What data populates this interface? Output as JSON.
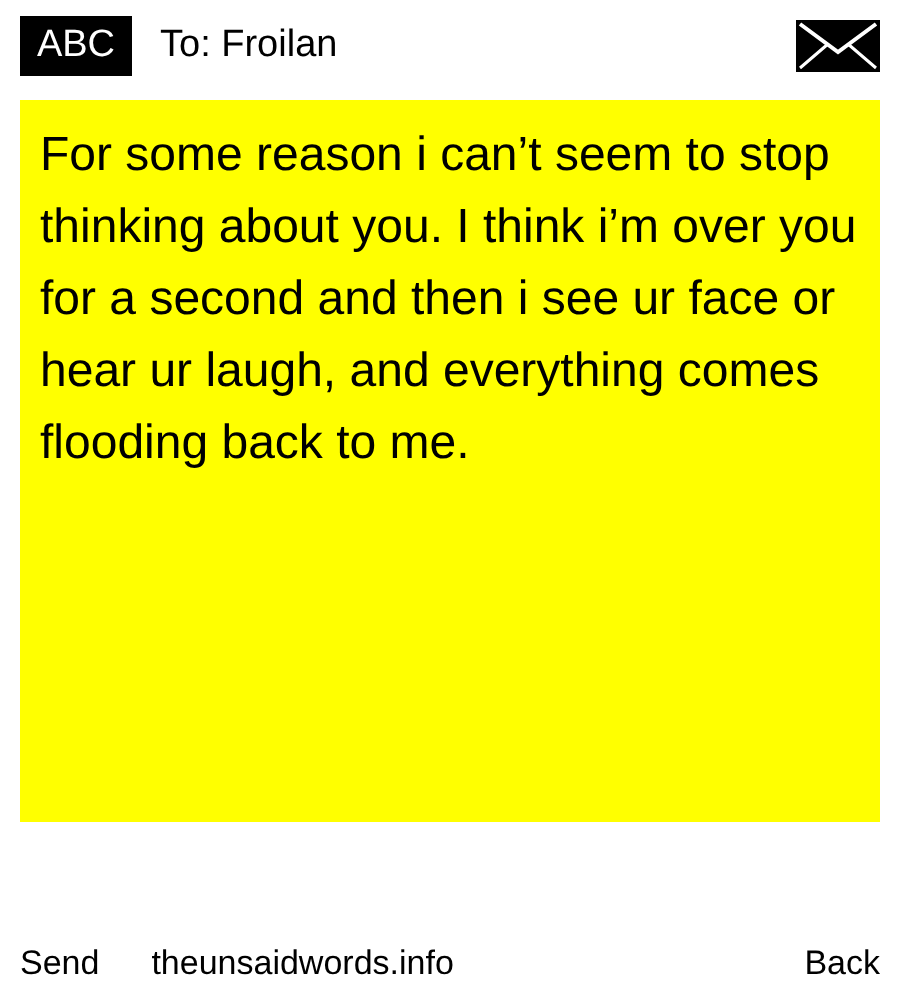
{
  "header": {
    "mode": "ABC",
    "recipient": "To: Froilan"
  },
  "message": "For some reason i can’t seem to stop thinking about you. I think i’m over you for a second and then i see ur face or hear ur laugh, and everything comes flooding back to me.",
  "footer": {
    "left": "Send",
    "center": "theunsaidwords.info",
    "right": "Back"
  }
}
